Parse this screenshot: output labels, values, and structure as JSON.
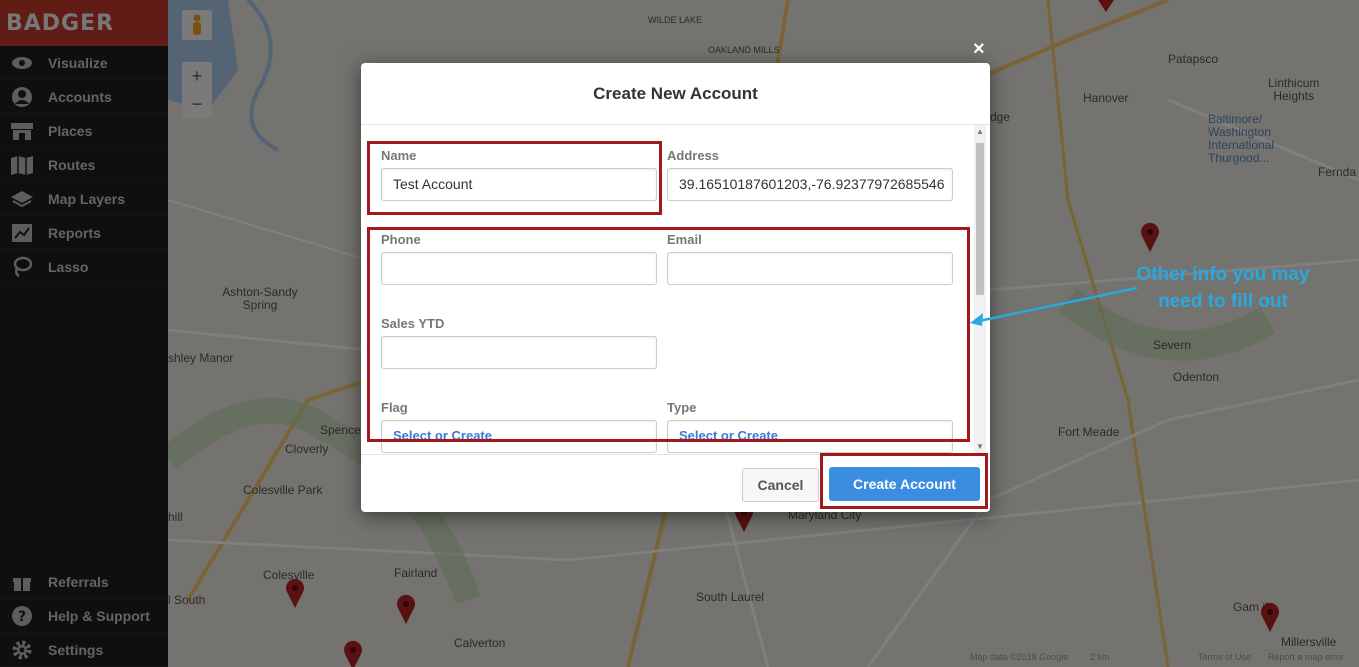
{
  "sidebar": {
    "logo": "BADGER",
    "items": [
      {
        "label": "Visualize",
        "icon": "eye-icon"
      },
      {
        "label": "Accounts",
        "icon": "person-icon"
      },
      {
        "label": "Places",
        "icon": "store-icon"
      },
      {
        "label": "Routes",
        "icon": "map-icon"
      },
      {
        "label": "Map Layers",
        "icon": "layers-icon"
      },
      {
        "label": "Reports",
        "icon": "chart-icon"
      },
      {
        "label": "Lasso",
        "icon": "lasso-icon"
      }
    ],
    "bottom_items": [
      {
        "label": "Referrals",
        "icon": "gift-icon"
      },
      {
        "label": "Help & Support",
        "icon": "question-icon"
      },
      {
        "label": "Settings",
        "icon": "gear-icon"
      }
    ]
  },
  "map": {
    "zoom_in": "+",
    "zoom_out": "−",
    "labels": {
      "wilde_lake": "WILDE LAKE",
      "oakland_mills": "OAKLAND MILLS",
      "ashton": "Ashton-Sandy\nSpring",
      "ashley_manor": "shley Manor",
      "spencerville": "Spence",
      "cloverly": "Cloverly",
      "colesville_park": "Colesville Park",
      "hill": "hill",
      "colesville": "Colesville",
      "fairland": "Fairland",
      "south": "l South",
      "calverton": "Calverton",
      "south_laurel": "South Laurel",
      "maryland_city": "Maryland City",
      "patapsco": "Patapsco",
      "linthicum": "Linthicum\nHeights",
      "hanover": "Hanover",
      "bwi": "Baltimore/\nWashington\nInternational\nThurgood...",
      "ferndale": "Fernda",
      "severn": "Severn",
      "odenton": "Odenton",
      "fort_meade": "Fort Meade",
      "gambrills": "Gam   ills",
      "millersville": "Millersville",
      "edge": "dge"
    },
    "footer": {
      "data": "Map data ©2018 Google",
      "scale": "2 km",
      "terms": "Terms of Use",
      "report": "Report a map error"
    }
  },
  "modal": {
    "title": "Create New Account",
    "fields": {
      "name": {
        "label": "Name",
        "value": "Test Account"
      },
      "address": {
        "label": "Address",
        "value": "39.16510187601203,-76.92377972685546"
      },
      "phone": {
        "label": "Phone",
        "value": ""
      },
      "email": {
        "label": "Email",
        "value": ""
      },
      "sales_ytd": {
        "label": "Sales YTD",
        "value": ""
      },
      "flag": {
        "label": "Flag",
        "value": "Select or Create"
      },
      "type": {
        "label": "Type",
        "value": "Select or Create"
      }
    },
    "cancel_label": "Cancel",
    "create_label": "Create Account",
    "close_label": "×"
  },
  "annotation": {
    "callout": "Other info you may\nneed to fill out",
    "color": "#2aa8e0",
    "box_color": "#a3191b"
  }
}
